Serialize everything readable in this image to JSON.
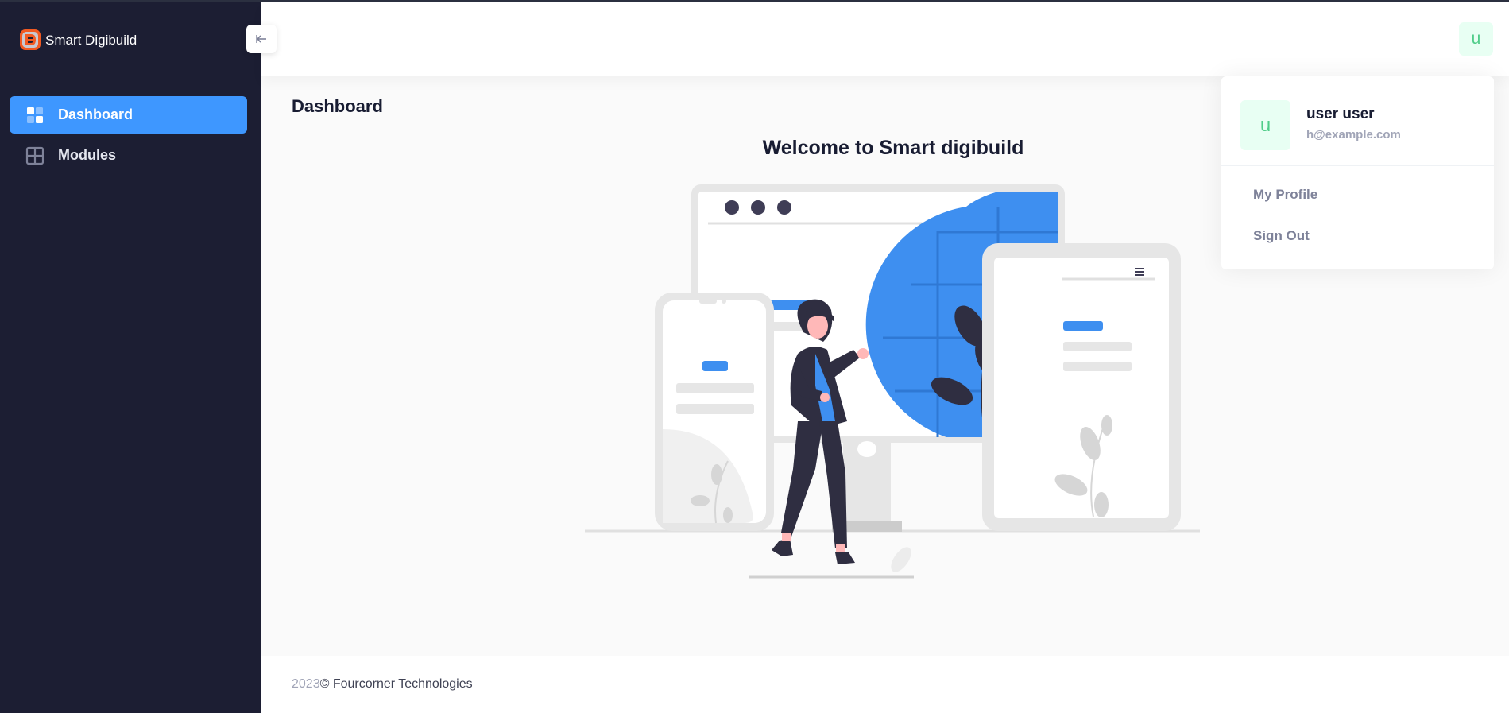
{
  "brand": {
    "name": "Smart Digibuild"
  },
  "sidebar": {
    "items": [
      {
        "label": "Dashboard",
        "icon": "dashboard-icon",
        "active": true
      },
      {
        "label": "Modules",
        "icon": "grid-icon",
        "active": false
      }
    ]
  },
  "header": {
    "avatar_letter": "u"
  },
  "main": {
    "page_title": "Dashboard",
    "welcome_text": "Welcome to Smart digibuild"
  },
  "user_menu": {
    "avatar_letter": "u",
    "name": "user user",
    "email": "h@example.com",
    "links": [
      "My Profile",
      "Sign Out"
    ]
  },
  "footer": {
    "year": "2023",
    "company": "© Fourcorner Technologies"
  },
  "colors": {
    "sidebar_bg": "#1c1e33",
    "primary": "#3e97ff",
    "avatar_bg": "#e8fff3",
    "avatar_text": "#50cd89",
    "illustration_dark": "#2f2e41"
  }
}
